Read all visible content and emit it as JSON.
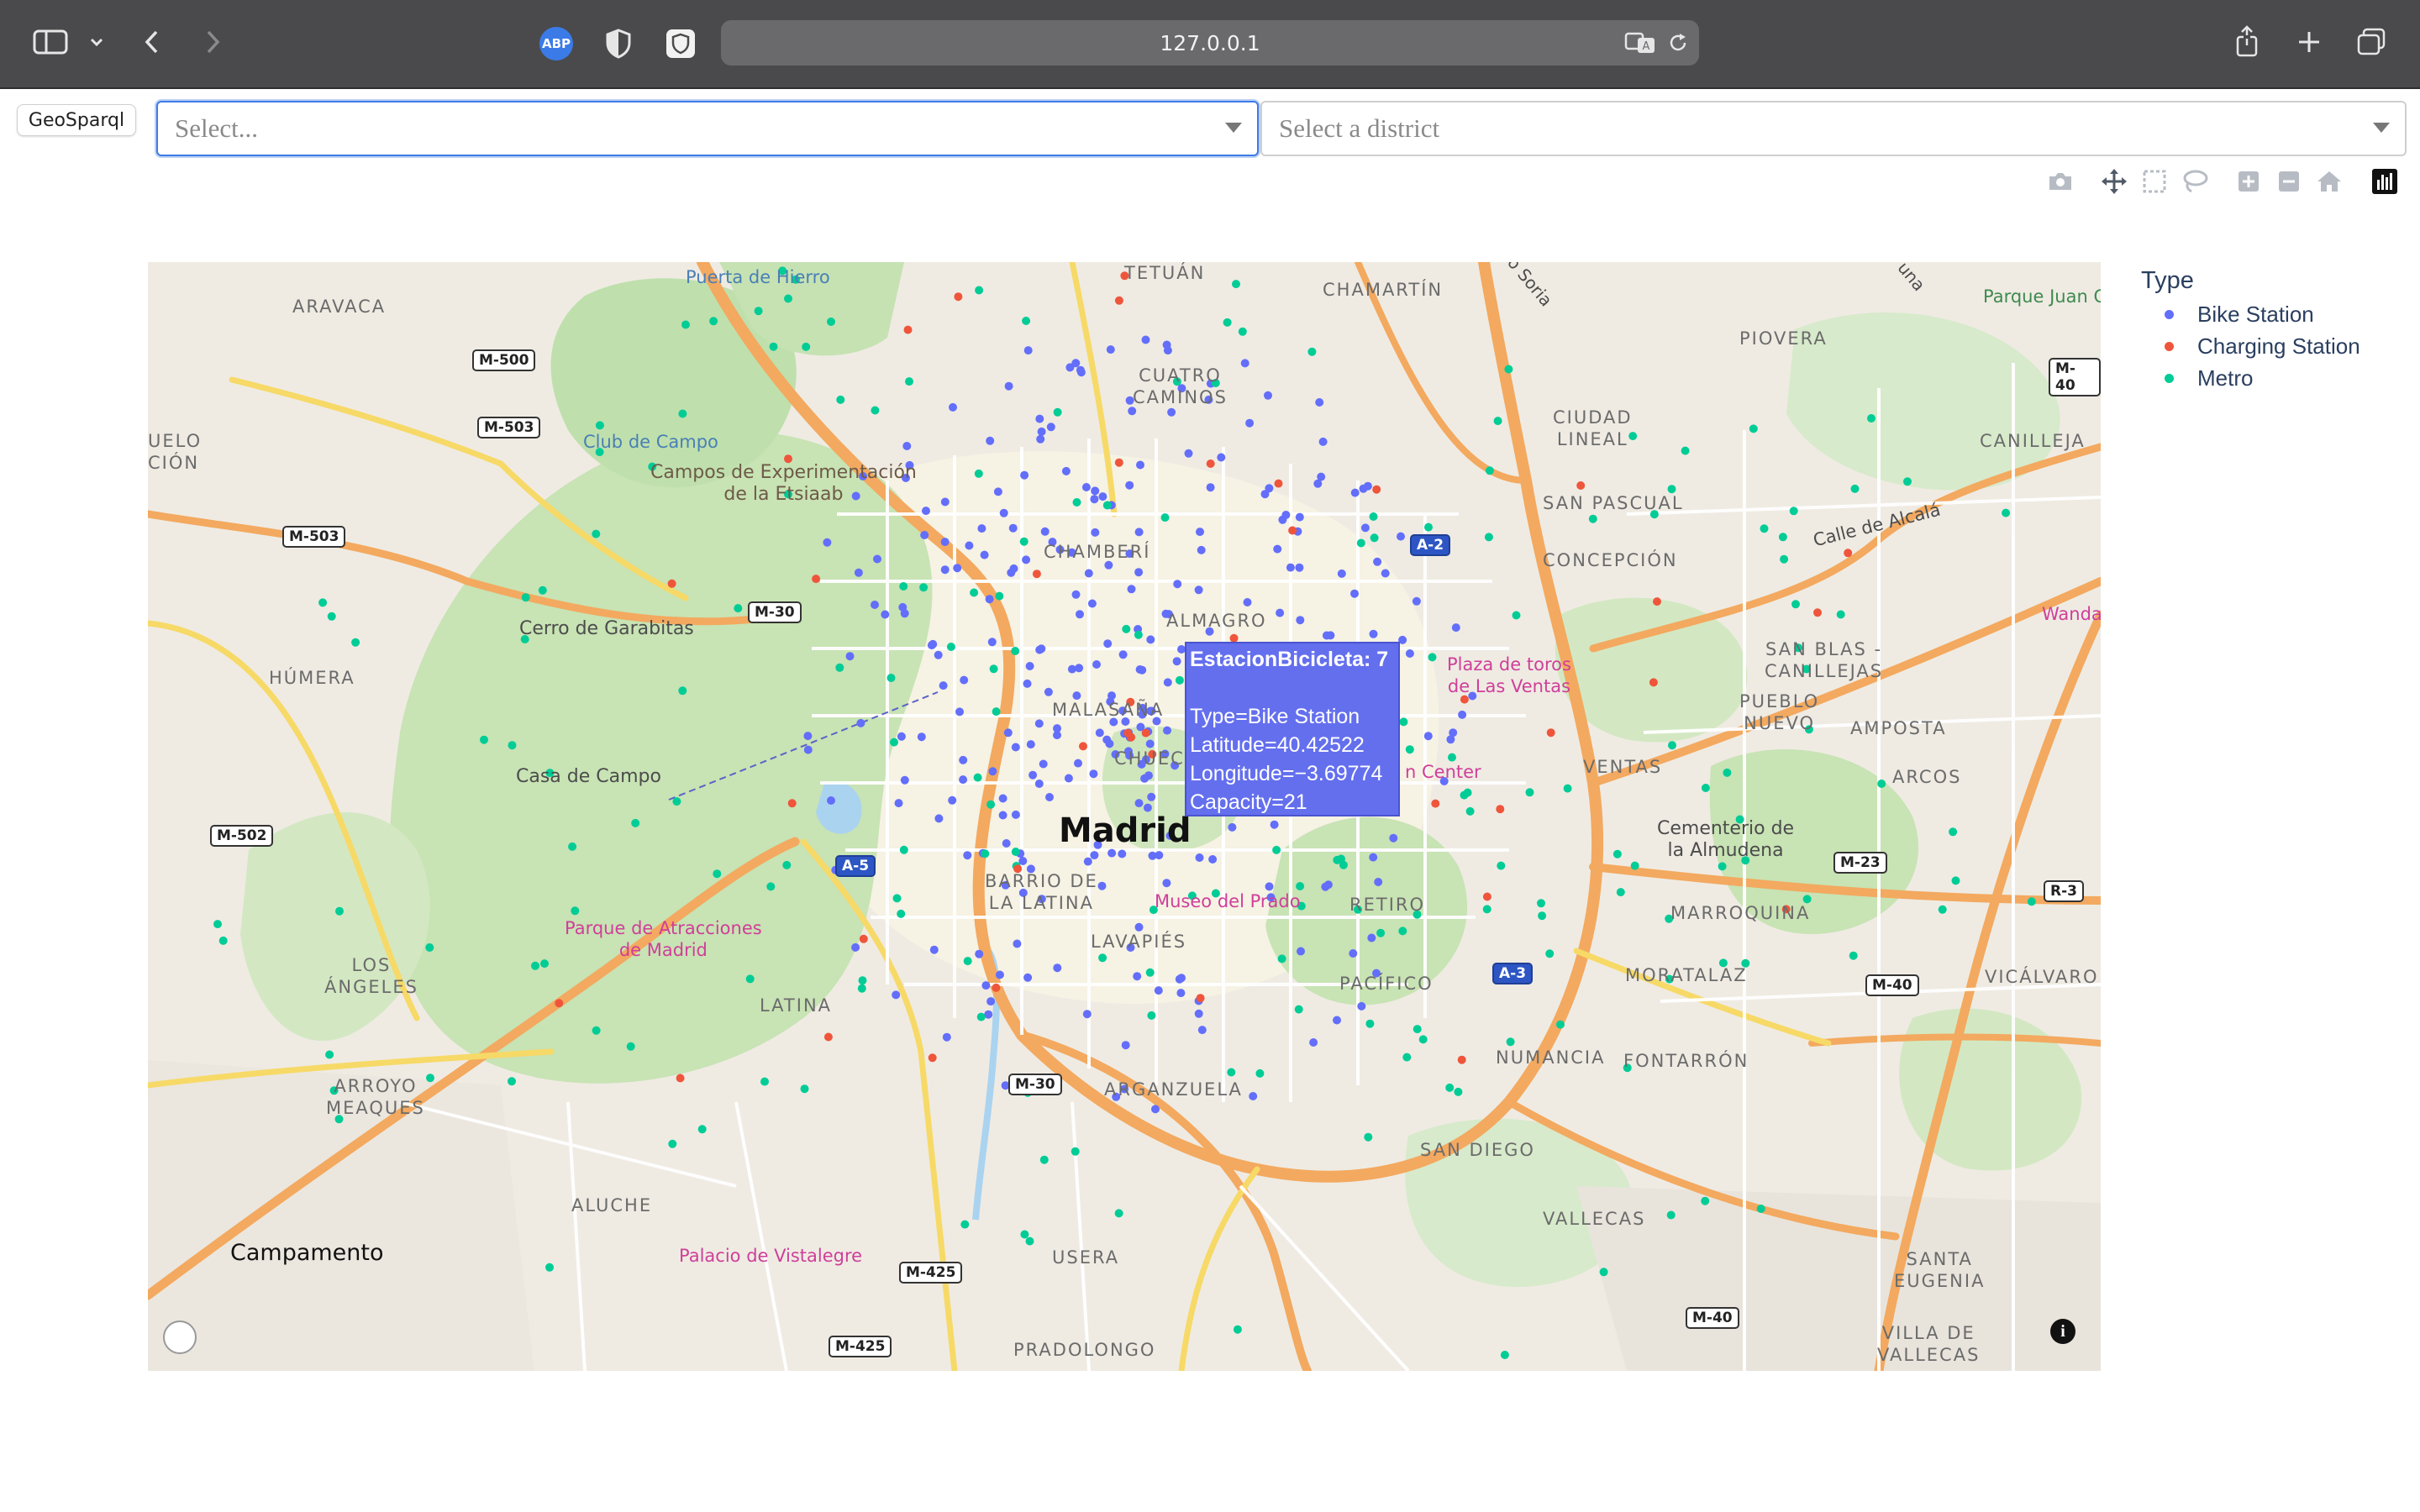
{
  "browser": {
    "url": "127.0.0.1",
    "icons": [
      "sidebar-icon",
      "chevron-down-icon",
      "back-icon",
      "forward-icon",
      "adblock-icon",
      "shield-icon",
      "privacy-icon",
      "translate-icon",
      "reload-icon",
      "share-icon",
      "new-tab-icon",
      "tabs-overview-icon"
    ],
    "adblock_label": "ABP"
  },
  "page": {
    "geosparql_button": "GeoSparql",
    "select_type": {
      "placeholder": "Select..."
    },
    "select_district": {
      "placeholder": "Select a district"
    },
    "modebar": [
      "camera-icon",
      "pan-icon",
      "box-select-icon",
      "lasso-select-icon",
      "zoom-in-icon",
      "zoom-out-icon",
      "reset-view-icon",
      "plotly-logo-icon"
    ]
  },
  "map": {
    "city": "Madrid",
    "labels": {
      "puerta_hierro": "Puerta de Hierro",
      "tetuan": "TETUÁN",
      "chamartin": "CHAMARTÍN",
      "aravaca": "ARAVACA",
      "cuatro_caminos": "CUATRO\nCAMINOS",
      "ciudad_lineal": "CIUDAD\nLINEAL",
      "piovera": "PIOVERA",
      "canillejas": "CANILLEJA",
      "parque_juan": "Parque Juan C",
      "club_campo": "Club de Campo",
      "campos_etsiaab": "Campos de Experimentación\nde la Etsiaab",
      "pozuelo": "UELO\nCIÓN",
      "chamberi": "CHAMBERÍ",
      "san_pascual": "SAN PASCUAL",
      "concepcion": "CONCEPCIÓN",
      "calle_alcala": "Calle de Alcalá",
      "cerro_garabitas": "Cerro de Garabitas",
      "almagro": "ALMAGRO",
      "plaza_toros": "Plaza de toros\nde Las Ventas",
      "wanda": "Wanda",
      "san_blas": "SAN BLAS -\nCANILLEJAS",
      "humera": "HÚMERA",
      "malasana": "MALASAÑA",
      "pueblo_nuevo": "PUEBLO\nNUEVO",
      "ampostas": "AMPOSTA",
      "chueca": "CHUEC",
      "center": "n Center",
      "ventas": "VENTAS",
      "arcos": "ARCOS",
      "casa_campo": "Casa de Campo",
      "cementerio": "Cementerio de\nla Almudena",
      "barrio_latina": "BARRIO DE\nLA LATINA",
      "museo_prado": "Museo del Prado",
      "retiro": "RETIRO",
      "marroquina": "MARROQUINA",
      "parque_atracciones": "Parque de Atracciones\nde Madrid",
      "lavapies": "LAVAPIÉS",
      "los_angeles": "LOS\nÁNGELES",
      "moratalaz": "MORATALAZ",
      "vicalvaro": "VICÁLVARO",
      "pacifico": "PACÍFICO",
      "latina": "LATINA",
      "numancia": "NUMANCIA",
      "fontarron": "FONTARRÓN",
      "arroyo_meaques": "ARROYO\nMEAQUES",
      "arganzuela": "ARGANZUELA",
      "san_diego": "SAN DIEGO",
      "aluche": "ALUCHE",
      "vallecas": "VALLECAS",
      "campamento": "Campamento",
      "palacio_vistalegre": "Palacio de Vistalegre",
      "usera": "USERA",
      "santa_eugenia": "SANTA\nEUGENIA",
      "villa_vallecas": "VILLA DE\nVALLECAS",
      "pradolongo": "PRADOLONGO",
      "soria": "o Soria",
      "una": "una"
    },
    "road_shields": {
      "m500": "M-500",
      "m503a": "M-503",
      "m503b": "M-503",
      "m30a": "M-30",
      "m502": "M-502",
      "a5": "A-5",
      "a2": "A-2",
      "m40a": "M-40",
      "m23": "M-23",
      "r3": "R-3",
      "m40b": "M-40",
      "a3": "A-3",
      "m40c": "M-40",
      "m30b": "M-30",
      "m425a": "M-425",
      "m425b": "M-425",
      "m40d": "M-40",
      "m40e": "M-40",
      "m40f": "M-40"
    },
    "tooltip": {
      "title": "EstacionBicicleta: 7",
      "type": "Type=Bike Station",
      "latitude": "Latitude=40.42522",
      "longitude": "Longitude=−3.69774",
      "capacity": "Capacity=21"
    }
  },
  "legend": {
    "title": "Type",
    "items": [
      {
        "label": "Bike Station",
        "color": "#636efa"
      },
      {
        "label": "Charging Station",
        "color": "#ef553b"
      },
      {
        "label": "Metro",
        "color": "#00cc96"
      }
    ]
  }
}
